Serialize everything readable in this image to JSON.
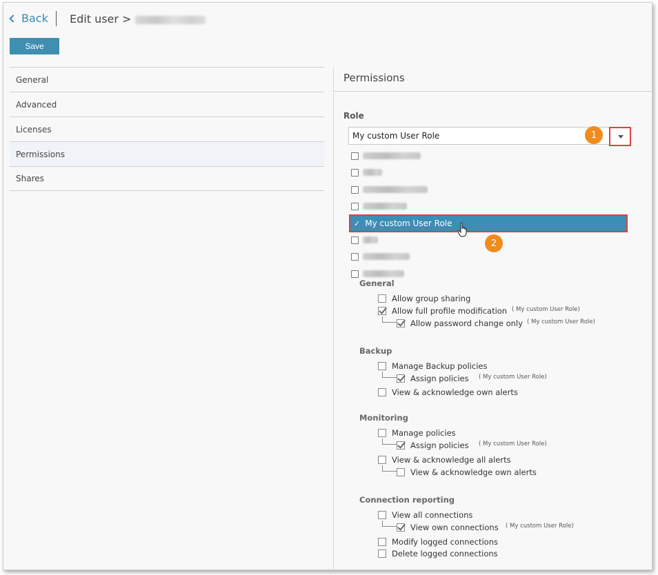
{
  "header": {
    "back_label": "Back",
    "edit_title": "Edit user >",
    "save_label": "Save"
  },
  "nav": {
    "items": [
      {
        "label": "General"
      },
      {
        "label": "Advanced"
      },
      {
        "label": "Licenses"
      },
      {
        "label": "Permissions"
      },
      {
        "label": "Shares"
      }
    ]
  },
  "permissions": {
    "title": "Permissions",
    "role_label": "Role",
    "selected_role": "My custom User Role"
  },
  "roles": {
    "selected_label": "My custom User Role"
  },
  "badges": {
    "one": "1",
    "two": "2"
  },
  "sections": {
    "general": {
      "heading": "General",
      "allow_group_sharing": "Allow group sharing",
      "allow_full_profile": "Allow full profile modification",
      "allow_full_profile_note": "( My custom User Role)",
      "allow_password_change": "Allow password change only",
      "allow_password_change_note": "( My custom User Role)"
    },
    "backup": {
      "heading": "Backup",
      "manage_policies": "Manage Backup policies",
      "assign_policies": "Assign policies",
      "assign_policies_note": "( My custom User Role)",
      "view_own_alerts": "View & acknowledge own alerts"
    },
    "monitoring": {
      "heading": "Monitoring",
      "manage_policies": "Manage policies",
      "assign_policies": "Assign policies",
      "assign_policies_note": "( My custom User Role)",
      "view_all_alerts": "View & acknowledge all alerts",
      "view_own_alerts": "View & acknowledge own alerts"
    },
    "connection": {
      "heading": "Connection reporting",
      "view_all": "View all connections",
      "view_own": "View own connections",
      "view_own_note": "( My custom User Role)",
      "modify_logged": "Modify logged connections",
      "delete_logged": "Delete logged connections"
    }
  },
  "colors": {
    "accent": "#3e8fb0",
    "highlight_border": "#e04040",
    "badge": "#f08c1c"
  }
}
